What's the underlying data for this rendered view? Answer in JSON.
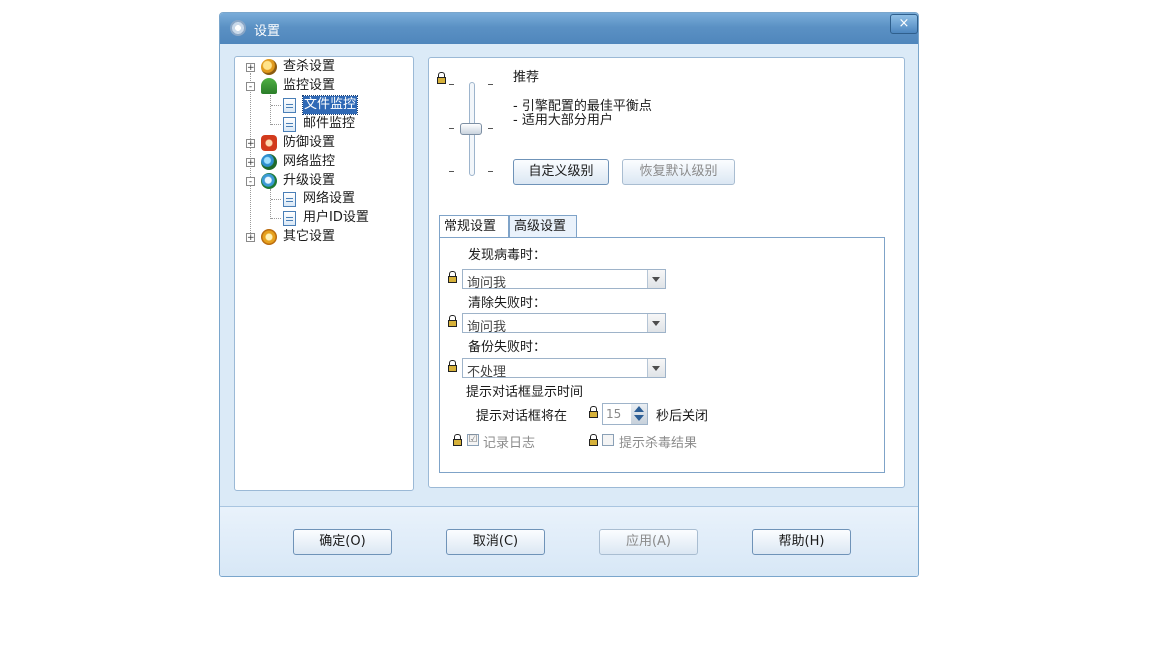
{
  "window": {
    "title": "设置",
    "close_label": "×"
  },
  "tree": [
    {
      "label": "查杀设置",
      "expander": "+"
    },
    {
      "label": "监控设置",
      "expander": "-"
    },
    {
      "label": "文件监控"
    },
    {
      "label": "邮件监控"
    },
    {
      "label": "防御设置",
      "expander": "+"
    },
    {
      "label": "网络监控",
      "expander": "+"
    },
    {
      "label": "升级设置",
      "expander": "-"
    },
    {
      "label": "网络设置"
    },
    {
      "label": "用户ID设置"
    },
    {
      "label": "其它设置",
      "expander": "+"
    }
  ],
  "level": {
    "name": "推荐",
    "desc1": "- 引擎配置的最佳平衡点",
    "desc2": "- 适用大部分用户",
    "custom_button": "自定义级别",
    "restore_button": "恢复默认级别",
    "slider_value": 0.5
  },
  "tabs": [
    {
      "label": "常规设置"
    },
    {
      "label": "高级设置"
    }
  ],
  "general": {
    "virus_found_label": "发现病毒时：",
    "virus_found_value": "询问我",
    "clean_failed_label": "清除失败时：",
    "clean_failed_value": "询问我",
    "backup_failed_label": "备份失败时：",
    "backup_failed_value": "不处理",
    "dialog_time_label": "提示对话框显示时间",
    "dialog_prefix": "提示对话框将在",
    "dialog_seconds": "15",
    "dialog_suffix": "秒后关闭",
    "log_label": "记录日志",
    "log_checked": "☑",
    "show_result_label": "提示杀毒结果"
  },
  "buttons": {
    "ok": "确定(O)",
    "cancel": "取消(C)",
    "apply": "应用(A)",
    "help": "帮助(H)"
  }
}
